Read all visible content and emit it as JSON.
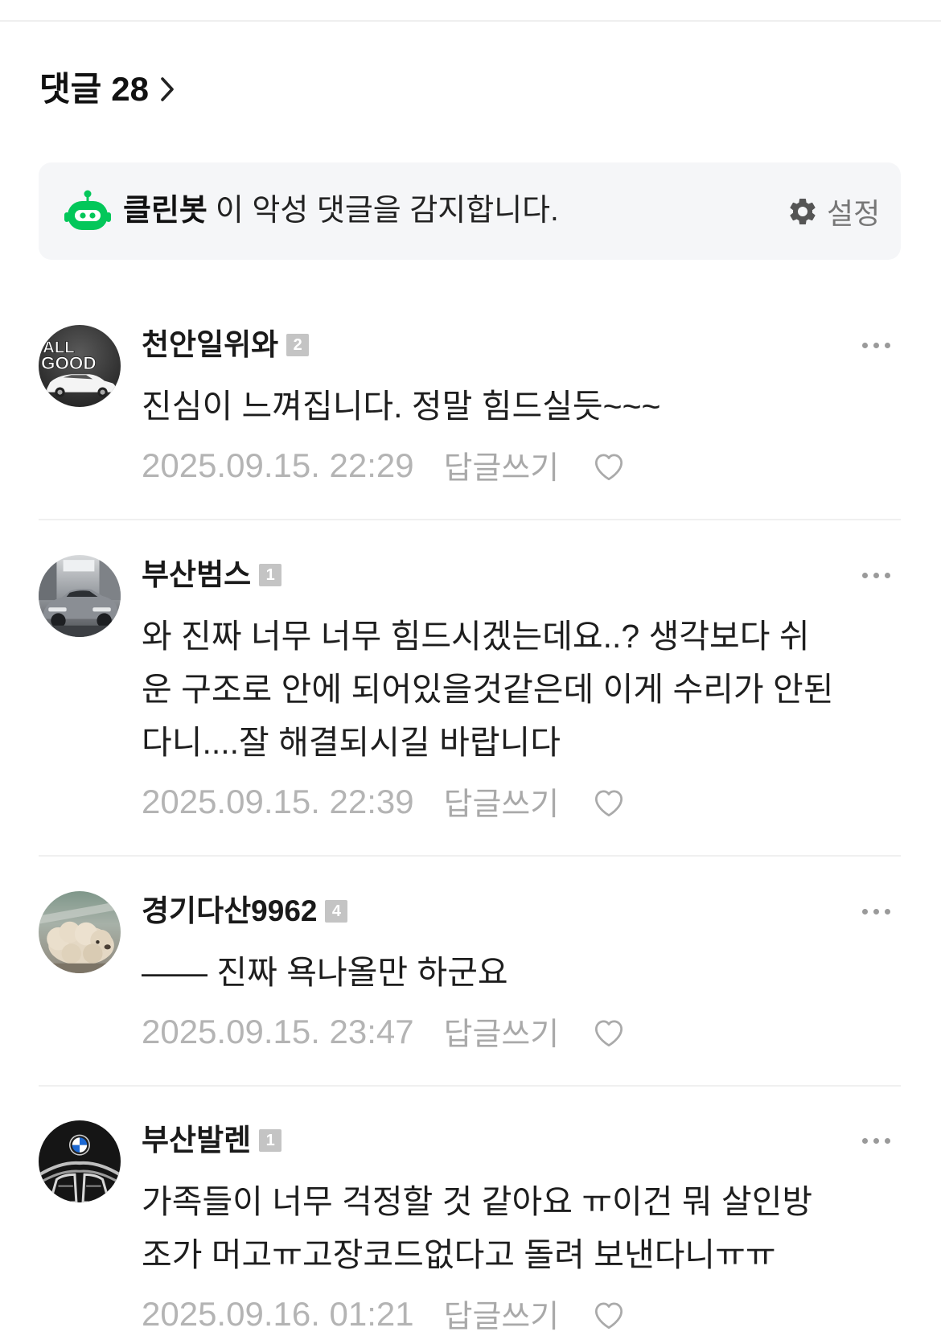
{
  "header": {
    "title": "댓글",
    "count": "28",
    "chevron_icon": "chevron-right-icon"
  },
  "cleanbot": {
    "name": "클린봇",
    "message": "이 악성 댓글을 감지합니다.",
    "settings_label": "설정",
    "icon": "robot-icon",
    "settings_icon": "gear-icon"
  },
  "actions": {
    "reply_label": "답글쓰기",
    "like_icon": "heart-outline-icon",
    "more_icon": "more-horizontal-icon"
  },
  "comments": [
    {
      "author": "천안일위와",
      "level": "2",
      "avatar_text": [
        "ALL",
        "GOOD"
      ],
      "lines": [
        "진심이 느껴집니다. 정말 힘드실듯~~~"
      ],
      "date": "2025.09.15. 22:29"
    },
    {
      "author": "부산범스",
      "level": "1",
      "lines": [
        "와 진짜 너무 너무 힘드시겠는데요..? 생각보다 쉬",
        "운 구조로 안에 되어있을것같은데 이게 수리가 안된",
        "다니....잘 해결되시길 바랍니다"
      ],
      "date": "2025.09.15. 22:39"
    },
    {
      "author": "경기다산9962",
      "level": "4",
      "lines": [
        "—— 진짜 욕나올만 하군요"
      ],
      "date": "2025.09.15. 23:47"
    },
    {
      "author": "부산발렌",
      "level": "1",
      "lines": [
        "가족들이 너무 걱정할 것 같아요 ㅠ이건 뭐 살인방",
        "조가 머고ㅠ고장코드없다고 돌려 보낸다니ㅠㅠ"
      ],
      "date": "2025.09.16. 01:21"
    }
  ],
  "colors": {
    "accent": "#03c75a",
    "banner_bg": "#f5f6f8",
    "meta_text": "#b4b4b4",
    "badge_bg": "#c4c4c4"
  }
}
